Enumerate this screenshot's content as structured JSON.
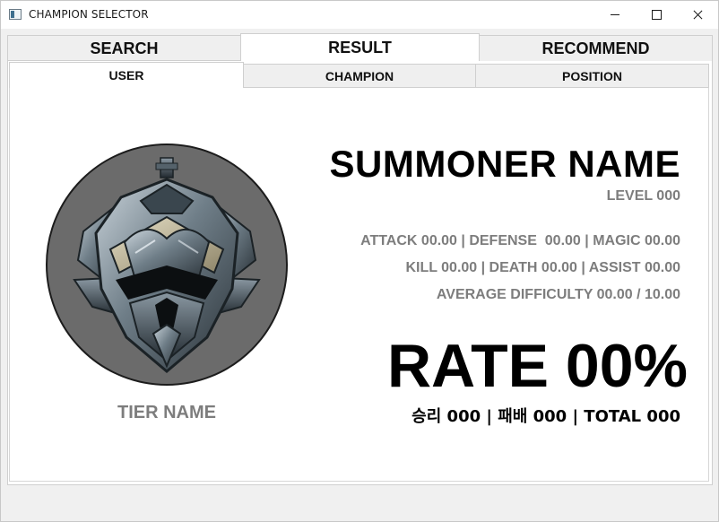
{
  "window": {
    "title": "CHAMPION SELECTOR",
    "icons": [
      "app-icon",
      "minimize-icon",
      "maximize-icon",
      "close-icon"
    ]
  },
  "main_tabs": [
    {
      "label": "SEARCH",
      "active": false
    },
    {
      "label": "RESULT",
      "active": true
    },
    {
      "label": "RECOMMEND",
      "active": false
    }
  ],
  "sub_tabs": [
    {
      "label": "USER",
      "active": true
    },
    {
      "label": "CHAMPION",
      "active": false
    },
    {
      "label": "POSITION",
      "active": false
    }
  ],
  "profile": {
    "emblem": "iron-tier-emblem-icon",
    "tier_name": "TIER NAME",
    "summoner_name": "SUMMONER NAME",
    "level": "LEVEL 000",
    "stats_line1": "ATTACK 00.00 | DEFENSE  00.00 | MAGIC 00.00",
    "stats_line2": "KILL 00.00 | DEATH 00.00 | ASSIST 00.00",
    "stats_line3": "AVERAGE DIFFICULTY 00.00 / 10.00",
    "rate": "RATE 00%",
    "record": "승리 000 | 패배 000 | TOTAL 000"
  },
  "colors": {
    "muted_text": "#7d7d7d",
    "emblem_bg": "#6b6b6b"
  }
}
